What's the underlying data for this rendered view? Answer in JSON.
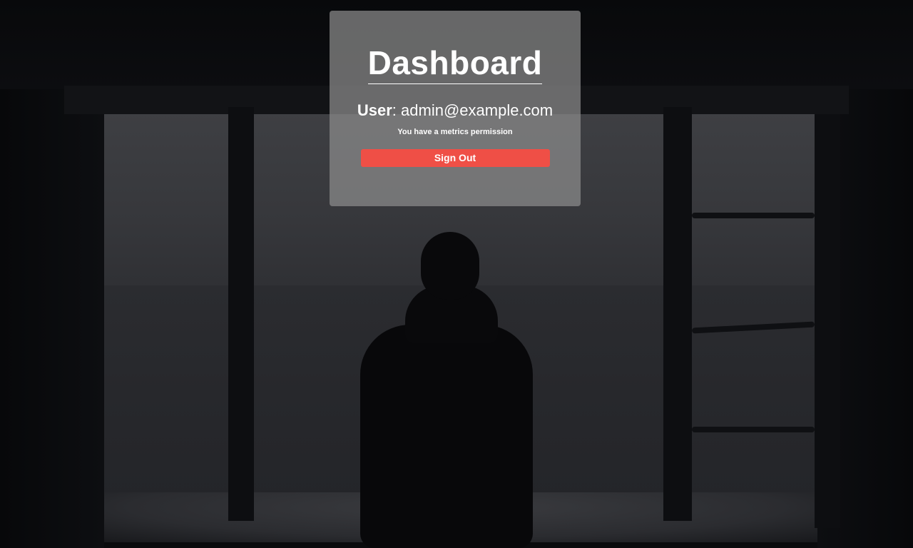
{
  "card": {
    "title": "Dashboard",
    "user_label": "User",
    "user_separator": ": ",
    "user_email": "admin@example.com",
    "permission_text": "You have a metrics permission",
    "signout_label": "Sign Out"
  },
  "colors": {
    "signout_button": "#ef4f46",
    "card_background": "rgba(140,140,140,0.72)",
    "text": "#ffffff"
  }
}
